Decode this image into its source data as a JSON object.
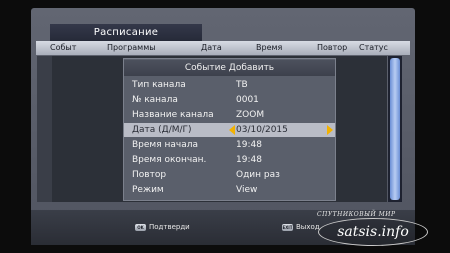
{
  "screen": {
    "title": "Расписание"
  },
  "table": {
    "columns": [
      "Событ",
      "Программы",
      "Дата",
      "Время",
      "Повтор",
      "Статус"
    ]
  },
  "dialog": {
    "title": "Событие Добавить",
    "rows": [
      {
        "label": "Тип канала",
        "value": "ТВ"
      },
      {
        "label": "№ канала",
        "value": "0001"
      },
      {
        "label": "Название канала",
        "value": "ZOOM"
      },
      {
        "label": "Дата (Д/М/Г)",
        "value": "03/10/2015",
        "selected": true
      },
      {
        "label": "Время начала",
        "value": "19:48"
      },
      {
        "label": "Время окончан.",
        "value": "19:48"
      },
      {
        "label": "Повтор",
        "value": "Один раз"
      },
      {
        "label": "Режим",
        "value": "View"
      }
    ]
  },
  "footer": {
    "ok_key": "OK",
    "ok_label": "Подтверди",
    "exit_key": "EXIT",
    "exit_label": "Выход"
  },
  "watermark": {
    "top_text": "СПУТНИКОВЫЙ МИР",
    "main_text": "satsis.info"
  },
  "colors": {
    "selection": "#b9bcc6",
    "arrow": "#f2b100",
    "scroll_thumb": "#b8ccf2"
  }
}
